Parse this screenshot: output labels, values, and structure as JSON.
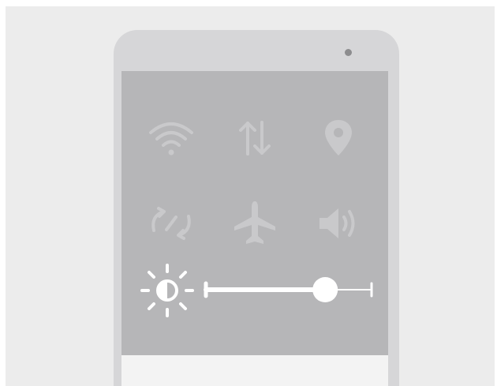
{
  "quick_settings": {
    "tiles": [
      {
        "id": "wifi",
        "icon": "wifi-icon"
      },
      {
        "id": "mobile-data",
        "icon": "data-transfer-icon"
      },
      {
        "id": "location",
        "icon": "location-pin-icon"
      },
      {
        "id": "auto-rotate",
        "icon": "auto-rotate-icon"
      },
      {
        "id": "airplane-mode",
        "icon": "airplane-icon"
      },
      {
        "id": "sound",
        "icon": "speaker-icon"
      }
    ],
    "brightness": {
      "icon": "brightness-icon",
      "level": 0.72
    }
  },
  "colors": {
    "background": "#ececec",
    "phone_body": "#d6d6d8",
    "screen": "#b6b6b8",
    "icon": "#c9c9cb",
    "slider": "#ffffff"
  }
}
